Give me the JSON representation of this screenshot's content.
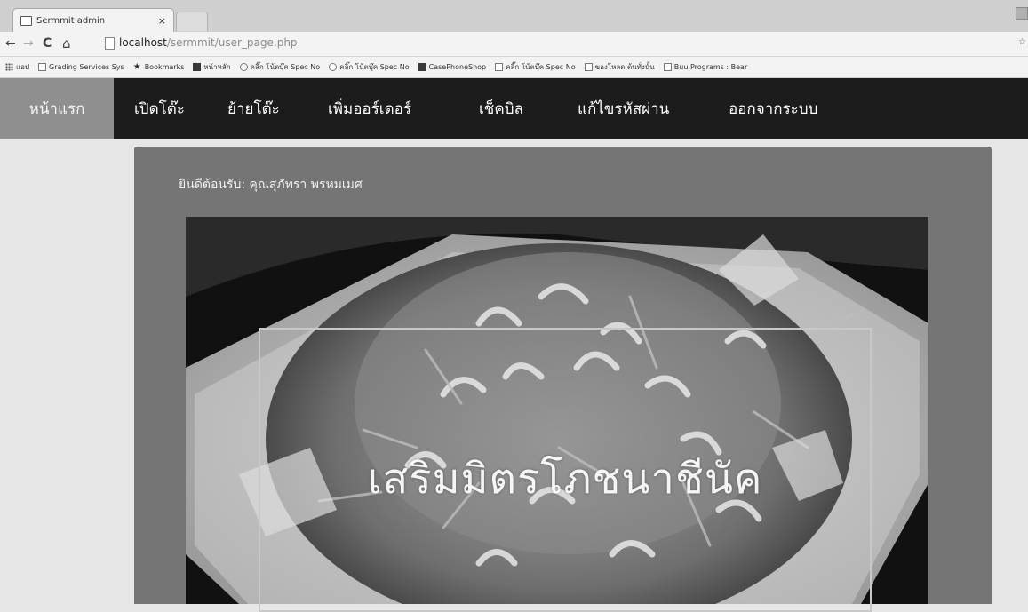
{
  "browser": {
    "tab_title": "Sermmit admin",
    "tab_close": "×",
    "back": "←",
    "forward": "→",
    "reload": "C",
    "home": "⌂",
    "url_host": "localhost",
    "url_path": "/sermmit/user_page.php",
    "right_mark": "☆"
  },
  "bookmarks": [
    {
      "label": "แอป",
      "icon": "apps-grid-icon"
    },
    {
      "label": "Grading Services Sys",
      "icon": "page-icon"
    },
    {
      "label": "Bookmarks",
      "icon": "star-icon"
    },
    {
      "label": "หน้าหลัก",
      "icon": "facebook-icon"
    },
    {
      "label": "คลิ๊ก โน้ตบุ๊ค Spec No",
      "icon": "site-icon"
    },
    {
      "label": "คลิ๊ก โน้ตบุ๊ค Spec No",
      "icon": "site-icon"
    },
    {
      "label": "CasePhoneShop",
      "icon": "facebook-icon"
    },
    {
      "label": "คลิ๊ก โน้ตบุ๊ค Spec No",
      "icon": "page-icon"
    },
    {
      "label": "ของโหลด ต้นทั่งนั้น",
      "icon": "page-icon"
    },
    {
      "label": "Buu Programs : Bear",
      "icon": "page-icon"
    }
  ],
  "nav": {
    "items": [
      {
        "label": "หน้าแรก",
        "active": true
      },
      {
        "label": "เปิดโต๊ะ",
        "active": false
      },
      {
        "label": "ย้ายโต๊ะ",
        "active": false
      },
      {
        "label": "เพิ่มออร์เดอร์",
        "active": false
      },
      {
        "label": "เช็คบิล",
        "active": false
      },
      {
        "label": "แก้ไขรหัสผ่าน",
        "active": false
      },
      {
        "label": "ออกจากระบบ",
        "active": false
      }
    ]
  },
  "main": {
    "welcome": "ยินดีต้อนรับ: คุณสุภัทรา พรหมเมศ",
    "banner_text": "เสริมมิตรโภชนาชีนัค"
  },
  "colors": {
    "navbar": "#1c1c1c",
    "nav_active": "#8f8f8f",
    "panel": "#757575",
    "page_bg": "#e6e6e6"
  }
}
